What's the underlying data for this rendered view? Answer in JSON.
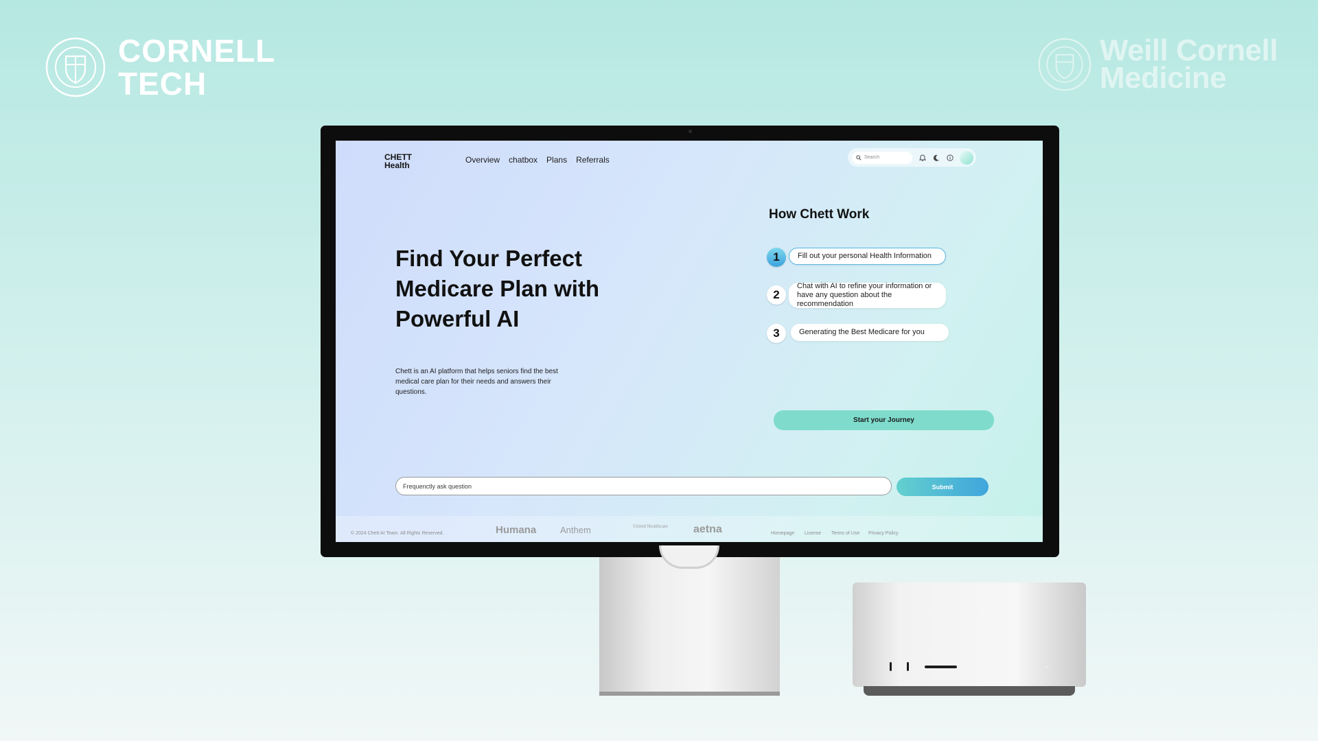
{
  "brands": {
    "left": {
      "line1": "CORNELL",
      "line2": "TECH"
    },
    "right": {
      "line1": "Weill Cornell",
      "line2": "Medicine"
    }
  },
  "app": {
    "logo": {
      "line1": "CHETT",
      "line2": "Health"
    },
    "nav": [
      "Overview",
      "chatbox",
      "Plans",
      "Referrals"
    ],
    "search": {
      "placeholder": "Search"
    },
    "toolbar_icons": [
      "bell-icon",
      "moon-icon",
      "info-icon",
      "avatar"
    ]
  },
  "hero": {
    "title": "Find Your Perfect Medicare Plan with Powerful AI",
    "description": "Chett is an AI platform that helps seniors find the best medical care plan for their needs and answers their questions."
  },
  "how": {
    "title": "How Chett Work",
    "steps": [
      {
        "num": "1",
        "text": "Fill out your personal Health Information"
      },
      {
        "num": "2",
        "text": "Chat with AI to refine your information or have any question about the recommendation"
      },
      {
        "num": "3",
        "text": "Generating the Best Medicare for you"
      }
    ],
    "cta": "Start your Journey"
  },
  "faq": {
    "placeholder": "Frequenctly ask question",
    "submit": "Submit"
  },
  "footer": {
    "copyright": "© 2024 Chett AI Team. All Rights Reserved.",
    "partners": [
      "Humana",
      "Anthem",
      "United Healthcare",
      "aetna"
    ],
    "links": [
      "Homepage",
      "License",
      "Terms of Use",
      "Privacy Policy"
    ]
  },
  "colors": {
    "accent": "#7fdccc",
    "submit": "#40a5dc",
    "background": "#b6e8e2"
  }
}
